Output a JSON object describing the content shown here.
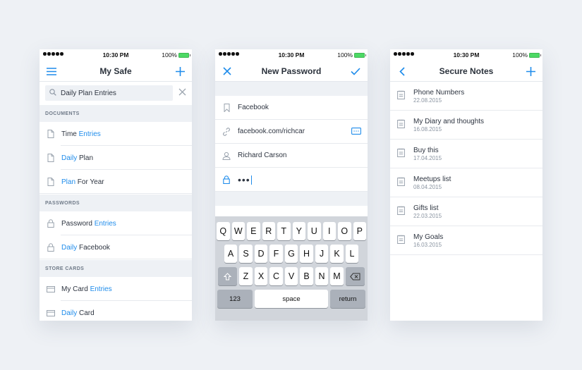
{
  "status_bar": {
    "time": "10:30 PM",
    "battery": "100%"
  },
  "safe": {
    "title": "My Safe",
    "search_value": "Daily Plan Entries",
    "sections": [
      {
        "header": "DOCUMENTS",
        "items": [
          {
            "prefix": "Time ",
            "highlight": "Entries",
            "suffix": ""
          },
          {
            "prefix": "",
            "highlight": "Daily",
            "suffix": " Plan"
          },
          {
            "prefix": "",
            "highlight": "Plan",
            "suffix": " For Year"
          }
        ]
      },
      {
        "header": "PASSWORDS",
        "items": [
          {
            "prefix": "Password ",
            "highlight": "Entries",
            "suffix": ""
          },
          {
            "prefix": "",
            "highlight": "Daily",
            "suffix": " Facebook"
          }
        ]
      },
      {
        "header": "STORE CARDS",
        "items": [
          {
            "prefix": "My Card ",
            "highlight": "Entries",
            "suffix": ""
          },
          {
            "prefix": "",
            "highlight": "Daily",
            "suffix": " Card"
          }
        ]
      }
    ]
  },
  "new_password": {
    "title": "New Password",
    "fields": {
      "name": "Facebook",
      "url": "facebook.com/richcar",
      "user": "Richard Carson",
      "password": "•••"
    },
    "keyboard": {
      "row1": [
        "Q",
        "W",
        "E",
        "R",
        "T",
        "Y",
        "U",
        "I",
        "O",
        "P"
      ],
      "row2": [
        "A",
        "S",
        "D",
        "F",
        "G",
        "H",
        "J",
        "K",
        "L"
      ],
      "row3": [
        "Z",
        "X",
        "C",
        "V",
        "B",
        "N",
        "M"
      ],
      "numbers": "123",
      "space": "space",
      "return": "return"
    }
  },
  "notes": {
    "title": "Secure Notes",
    "items": [
      {
        "title": "Phone Numbers",
        "date": "22.08.2015"
      },
      {
        "title": "My Diary and thoughts",
        "date": "16.08.2015"
      },
      {
        "title": "Buy this",
        "date": "17.04.2015"
      },
      {
        "title": "Meetups list",
        "date": "08.04.2015"
      },
      {
        "title": "Gifts list",
        "date": "22.03.2015"
      },
      {
        "title": "My Goals",
        "date": "16.03.2015"
      }
    ]
  },
  "colors": {
    "accent": "#1f8ceb",
    "background": "#eef1f5",
    "battery": "#4cd964"
  }
}
